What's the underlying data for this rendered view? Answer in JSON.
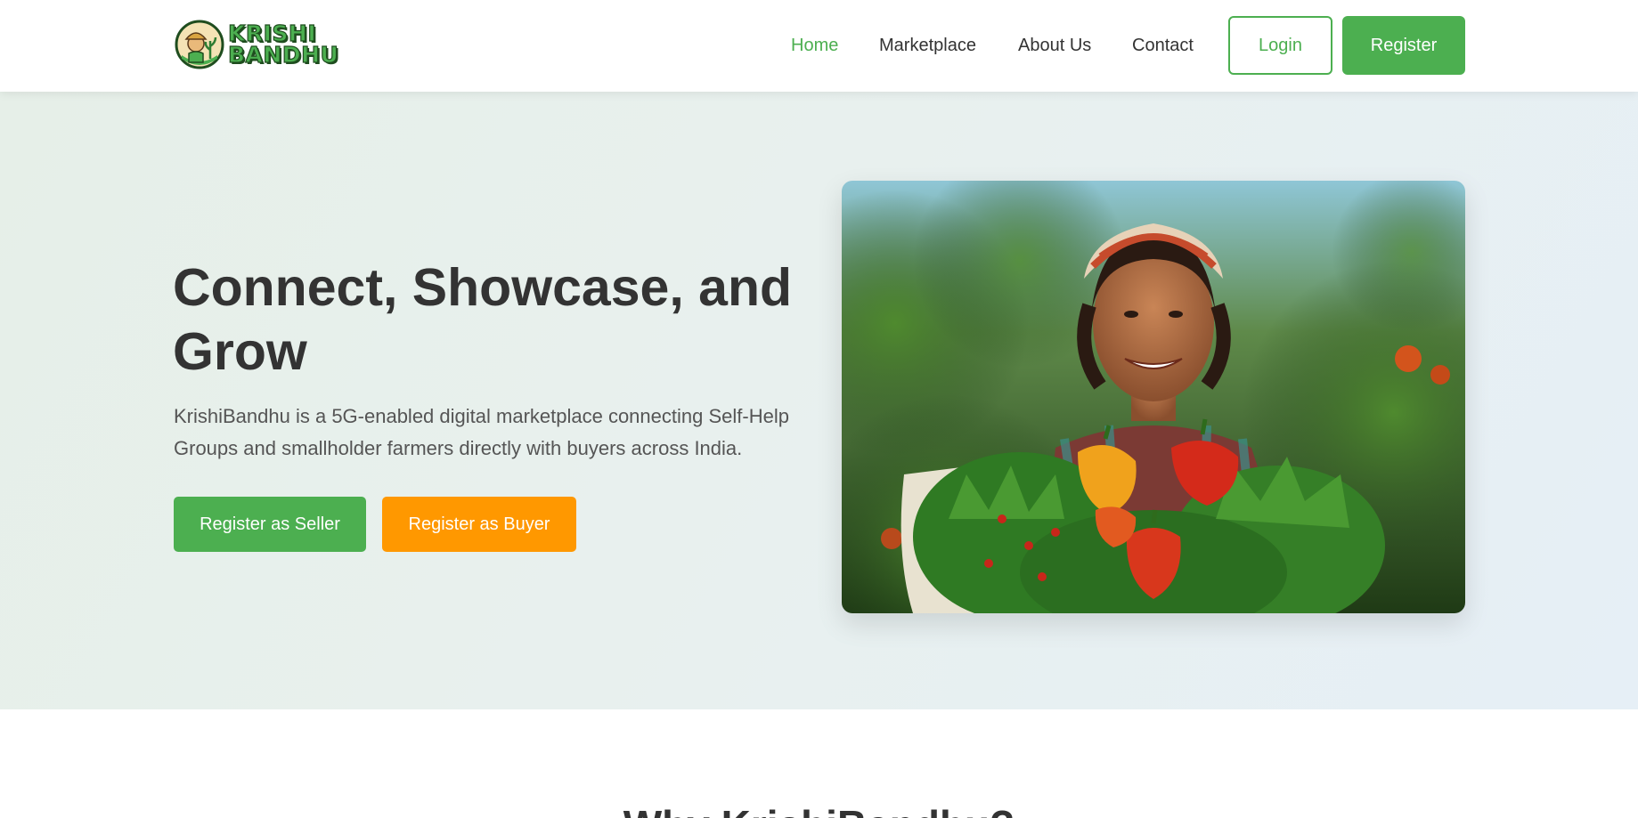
{
  "brand": {
    "name_line1": "KRISHI",
    "name_line2": "BANDHU",
    "colors": {
      "primary": "#4caf50",
      "accent": "#ff9800",
      "dark": "#1f4d1f"
    }
  },
  "nav": {
    "items": [
      {
        "label": "Home",
        "active": true
      },
      {
        "label": "Marketplace",
        "active": false
      },
      {
        "label": "About Us",
        "active": false
      },
      {
        "label": "Contact",
        "active": false
      }
    ],
    "login_label": "Login",
    "register_label": "Register"
  },
  "hero": {
    "title": "Connect, Showcase, and Grow",
    "subtitle": "KrishiBandhu is a 5G-enabled digital marketplace connecting Self-Help Groups and smallholder farmers directly with buyers across India.",
    "seller_button": "Register as Seller",
    "buyer_button": "Register as Buyer",
    "image_icon": "farmer-woman-with-vegetables-photo"
  },
  "next_section": {
    "heading": "Why KrishiBandhu?"
  }
}
